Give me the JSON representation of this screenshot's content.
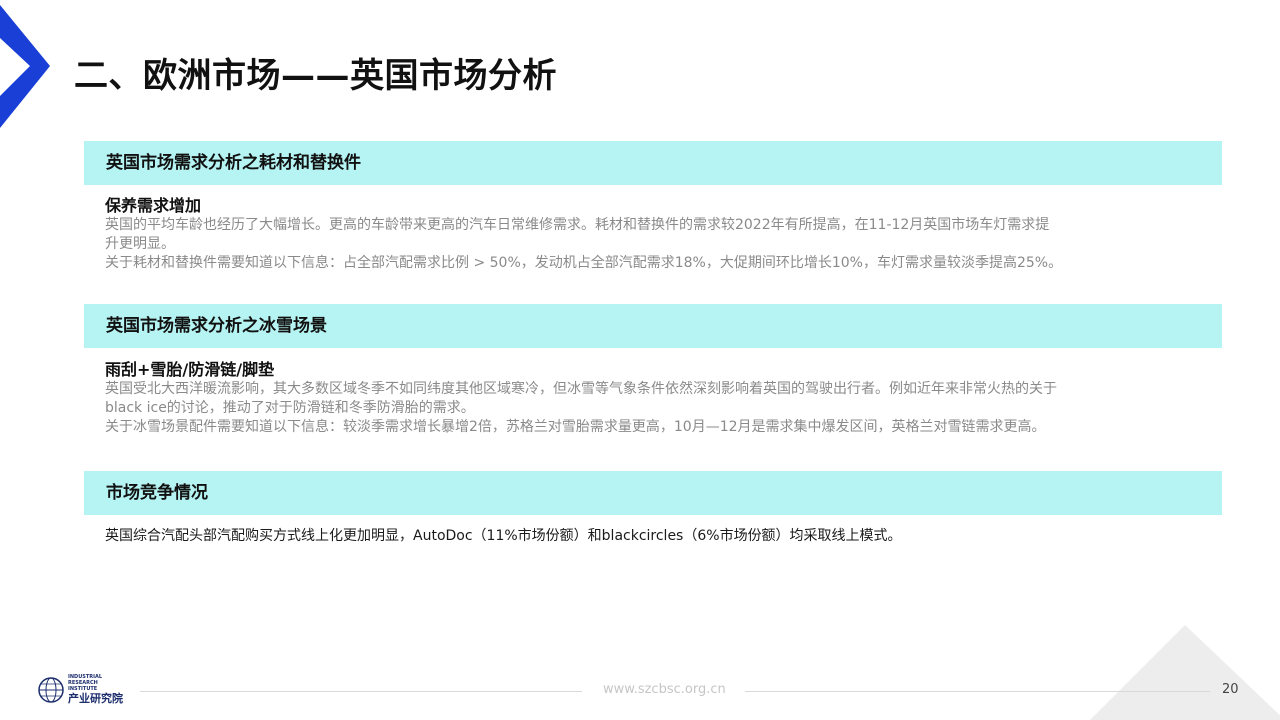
{
  "title": "二、欧洲市场——英国市场分析",
  "sections": [
    {
      "header": "英国市场需求分析之耗材和替换件",
      "subtitle": "保养需求增加",
      "lines": [
        "英国的平均车龄也经历了大幅增长。更高的车龄带来更高的汽车日常维修需求。耗材和替换件的需求较2022年有所提高，在11-12月英国市场车灯需求提",
        "升更明显。",
        "关于耗材和替换件需要知道以下信息：占全部汽配需求比例 > 50%，发动机占全部汽配需求18%，大促期间环比增长10%，车灯需求量较淡季提高25%。"
      ]
    },
    {
      "header": "英国市场需求分析之冰雪场景",
      "subtitle": "雨刮+雪胎/防滑链/脚垫",
      "lines": [
        "英国受北大西洋暖流影响，其大多数区域冬季不如同纬度其他区域寒冷，但冰雪等气象条件依然深刻影响着英国的驾驶出行者。例如近年来非常火热的关于",
        "black ice的讨论，推动了对于防滑链和冬季防滑胎的需求。",
        "关于冰雪场景配件需要知道以下信息：较淡季需求增长暴增2倍，苏格兰对雪胎需求量更高，10月—12月是需求集中爆发区间，英格兰对雪链需求更高。"
      ]
    },
    {
      "header": "市场竞争情况",
      "text": "英国综合汽配头部汽配购买方式线上化更加明显，AutoDoc（11%市场份额）和blackcircles（6%市场份额）均采取线上模式。"
    }
  ],
  "footer": {
    "logo_en": "INDUSTRIAL RESEARCH INSTITUTE",
    "logo_cn": "产业研究院",
    "url": "www.szcbsc.org.cn",
    "page": "20"
  },
  "colors": {
    "accent": "#1a3fd6",
    "header_bg": "#b6f4f4",
    "body_gray": "#8a8a8a"
  }
}
